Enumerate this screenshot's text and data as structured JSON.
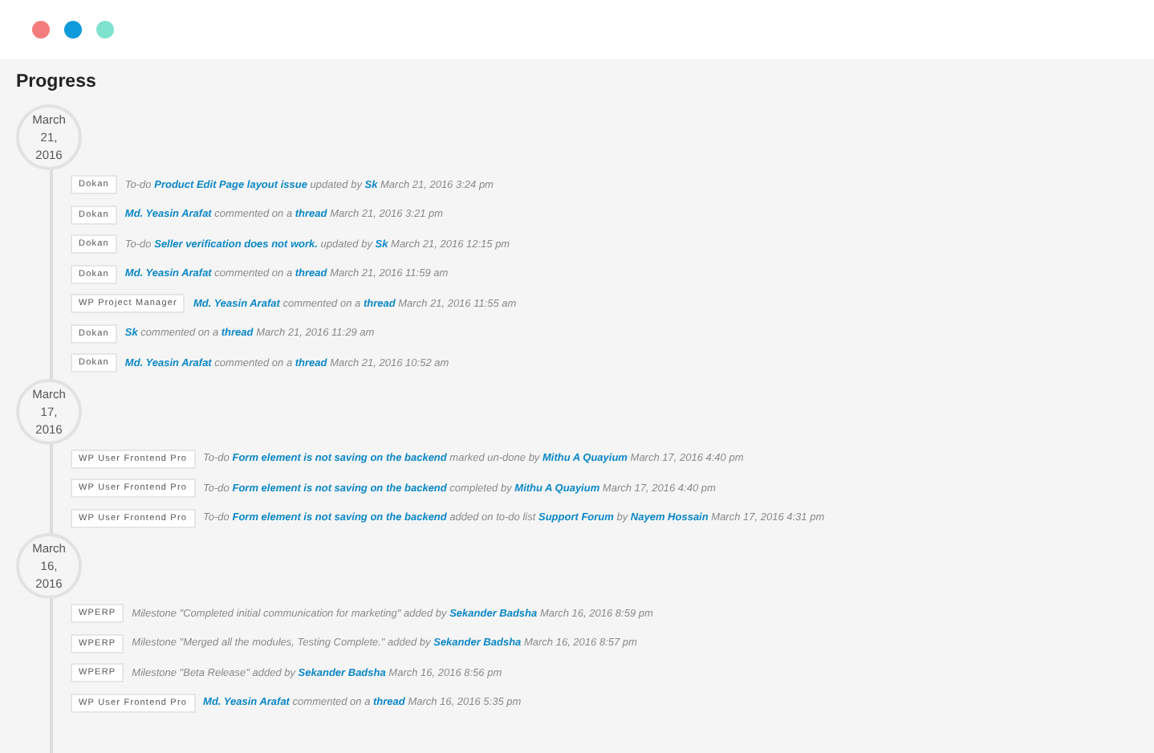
{
  "window": {
    "dots": [
      {
        "color": "#f47c7c"
      },
      {
        "color": "#0f9ad9"
      },
      {
        "color": "#7ee2cf"
      }
    ]
  },
  "title": "Progress",
  "groups": [
    {
      "date": "March 21, 2016",
      "items": [
        {
          "tag": "Dokan",
          "parts": [
            {
              "text": "To-do ",
              "link": false
            },
            {
              "text": "Product Edit Page layout issue",
              "link": true
            },
            {
              "text": " updated by ",
              "link": false
            },
            {
              "text": "Sk",
              "link": true
            },
            {
              "text": " March 21, 2016 3:24 pm",
              "link": false
            }
          ]
        },
        {
          "tag": "Dokan",
          "parts": [
            {
              "text": "Md. Yeasin Arafat",
              "link": true
            },
            {
              "text": " commented on a ",
              "link": false
            },
            {
              "text": "thread",
              "link": true
            },
            {
              "text": " March 21, 2016 3:21 pm",
              "link": false
            }
          ]
        },
        {
          "tag": "Dokan",
          "parts": [
            {
              "text": "To-do ",
              "link": false
            },
            {
              "text": "Seller verification does not work.",
              "link": true
            },
            {
              "text": " updated by ",
              "link": false
            },
            {
              "text": "Sk",
              "link": true
            },
            {
              "text": " March 21, 2016 12:15 pm",
              "link": false
            }
          ]
        },
        {
          "tag": "Dokan",
          "parts": [
            {
              "text": "Md. Yeasin Arafat",
              "link": true
            },
            {
              "text": " commented on a ",
              "link": false
            },
            {
              "text": "thread",
              "link": true
            },
            {
              "text": " March 21, 2016 11:59 am",
              "link": false
            }
          ]
        },
        {
          "tag": "WP Project Manager",
          "parts": [
            {
              "text": "Md. Yeasin Arafat",
              "link": true
            },
            {
              "text": " commented on a ",
              "link": false
            },
            {
              "text": "thread",
              "link": true
            },
            {
              "text": " March 21, 2016 11:55 am",
              "link": false
            }
          ]
        },
        {
          "tag": "Dokan",
          "parts": [
            {
              "text": "Sk",
              "link": true
            },
            {
              "text": " commented on a ",
              "link": false
            },
            {
              "text": "thread",
              "link": true
            },
            {
              "text": " March 21, 2016 11:29 am",
              "link": false
            }
          ]
        },
        {
          "tag": "Dokan",
          "parts": [
            {
              "text": "Md. Yeasin Arafat",
              "link": true
            },
            {
              "text": " commented on a ",
              "link": false
            },
            {
              "text": "thread",
              "link": true
            },
            {
              "text": " March 21, 2016 10:52 am",
              "link": false
            }
          ]
        }
      ]
    },
    {
      "date": "March 17, 2016",
      "items": [
        {
          "tag": "WP User Frontend Pro",
          "parts": [
            {
              "text": "To-do ",
              "link": false
            },
            {
              "text": "Form element is not saving on the backend",
              "link": true
            },
            {
              "text": " marked un-done by ",
              "link": false
            },
            {
              "text": "Mithu A Quayium",
              "link": true
            },
            {
              "text": " March 17, 2016 4:40 pm",
              "link": false
            }
          ]
        },
        {
          "tag": "WP User Frontend Pro",
          "parts": [
            {
              "text": "To-do ",
              "link": false
            },
            {
              "text": "Form element is not saving on the backend",
              "link": true
            },
            {
              "text": " completed by ",
              "link": false
            },
            {
              "text": "Mithu A Quayium",
              "link": true
            },
            {
              "text": " March 17, 2016 4:40 pm",
              "link": false
            }
          ]
        },
        {
          "tag": "WP User Frontend Pro",
          "parts": [
            {
              "text": "To-do ",
              "link": false
            },
            {
              "text": "Form element is not saving on the backend",
              "link": true
            },
            {
              "text": " added on to-do list ",
              "link": false
            },
            {
              "text": "Support Forum",
              "link": true
            },
            {
              "text": " by ",
              "link": false
            },
            {
              "text": "Nayem Hossain",
              "link": true
            },
            {
              "text": " March 17, 2016 4:31 pm",
              "link": false
            }
          ]
        }
      ]
    },
    {
      "date": "March 16, 2016",
      "items": [
        {
          "tag": "WPERP",
          "parts": [
            {
              "text": "Milestone \"Completed initial communication for marketing\" added by ",
              "link": false
            },
            {
              "text": "Sekander Badsha",
              "link": true
            },
            {
              "text": " March 16, 2016 8:59 pm",
              "link": false
            }
          ]
        },
        {
          "tag": "WPERP",
          "parts": [
            {
              "text": "Milestone \"Merged all the modules, Testing Complete.\" added by ",
              "link": false
            },
            {
              "text": "Sekander Badsha",
              "link": true
            },
            {
              "text": " March 16, 2016 8:57 pm",
              "link": false
            }
          ]
        },
        {
          "tag": "WPERP",
          "parts": [
            {
              "text": "Milestone \"Beta Release\" added by ",
              "link": false
            },
            {
              "text": "Sekander Badsha",
              "link": true
            },
            {
              "text": " March 16, 2016 8:56 pm",
              "link": false
            }
          ]
        },
        {
          "tag": "WP User Frontend Pro",
          "parts": [
            {
              "text": "Md. Yeasin Arafat",
              "link": true
            },
            {
              "text": " commented on a ",
              "link": false
            },
            {
              "text": "thread",
              "link": true
            },
            {
              "text": " March 16, 2016 5:35 pm",
              "link": false
            }
          ]
        }
      ]
    }
  ]
}
